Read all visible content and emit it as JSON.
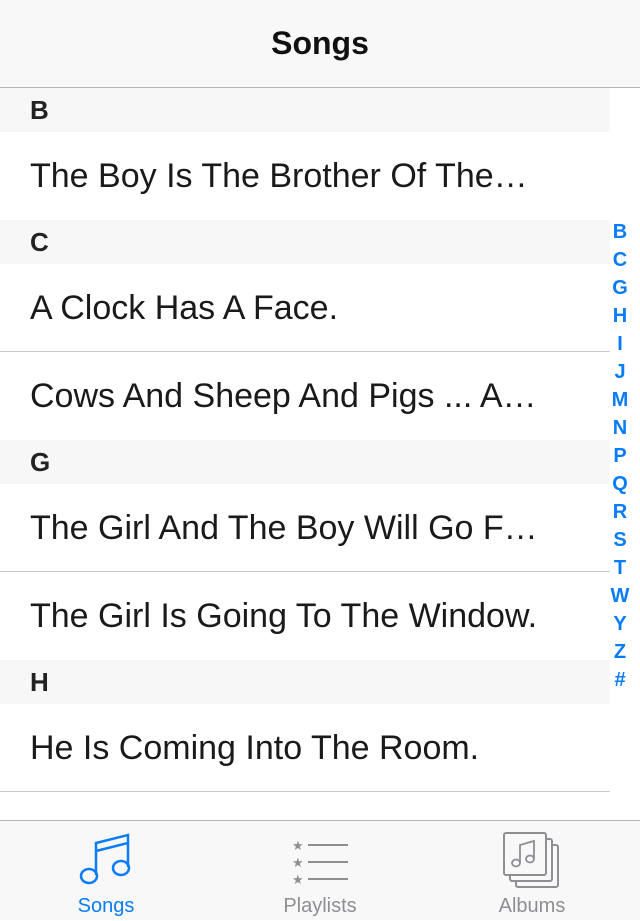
{
  "navbar": {
    "title": "Songs"
  },
  "sections": [
    {
      "letter": "B",
      "songs": [
        "The Boy Is The Brother Of The…"
      ]
    },
    {
      "letter": "C",
      "songs": [
        "A Clock Has A Face.",
        "Cows And Sheep And Pigs ... A…"
      ]
    },
    {
      "letter": "G",
      "songs": [
        "The Girl And The Boy Will Go F…",
        "The Girl Is Going To The Window."
      ]
    },
    {
      "letter": "H",
      "songs": [
        "He Is Coming Into The Room."
      ]
    }
  ],
  "index": [
    "B",
    "C",
    "G",
    "H",
    "I",
    "J",
    "M",
    "N",
    "P",
    "Q",
    "R",
    "S",
    "T",
    "W",
    "Y",
    "Z",
    "#"
  ],
  "tabbar": {
    "tabs": [
      {
        "label": "Songs",
        "icon": "music-note-icon",
        "active": true
      },
      {
        "label": "Playlists",
        "icon": "playlist-icon",
        "active": false
      },
      {
        "label": "Albums",
        "icon": "albums-icon",
        "active": false
      }
    ]
  },
  "colors": {
    "accent": "#0a7cf5",
    "inactive": "#8e8e93",
    "section_bg": "#f7f7f7",
    "bar_bg": "#f8f8f8"
  }
}
